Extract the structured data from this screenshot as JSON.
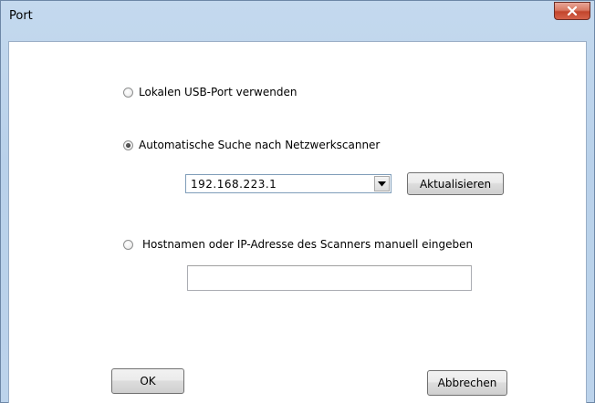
{
  "window": {
    "title": "Port",
    "close_icon": "close-icon"
  },
  "options": {
    "usb": {
      "label": "Lokalen USB-Port verwenden",
      "checked": false
    },
    "auto": {
      "label": "Automatische Suche nach Netzwerkscanner",
      "checked": true
    },
    "manual": {
      "label": "Hostnamen oder IP-Adresse des Scanners manuell eingeben",
      "checked": false
    }
  },
  "scanner_select": {
    "value": "192.168.223.1",
    "arrow_icon": "chevron-down-icon"
  },
  "refresh_button": {
    "label": "Aktualisieren"
  },
  "manual_input": {
    "value": ""
  },
  "footer": {
    "ok_label": "OK",
    "cancel_label": "Abbrechen"
  },
  "colors": {
    "title_bar": "#bcd3eb",
    "close_button": "#c9563f",
    "client_bg": "#ffffff"
  }
}
